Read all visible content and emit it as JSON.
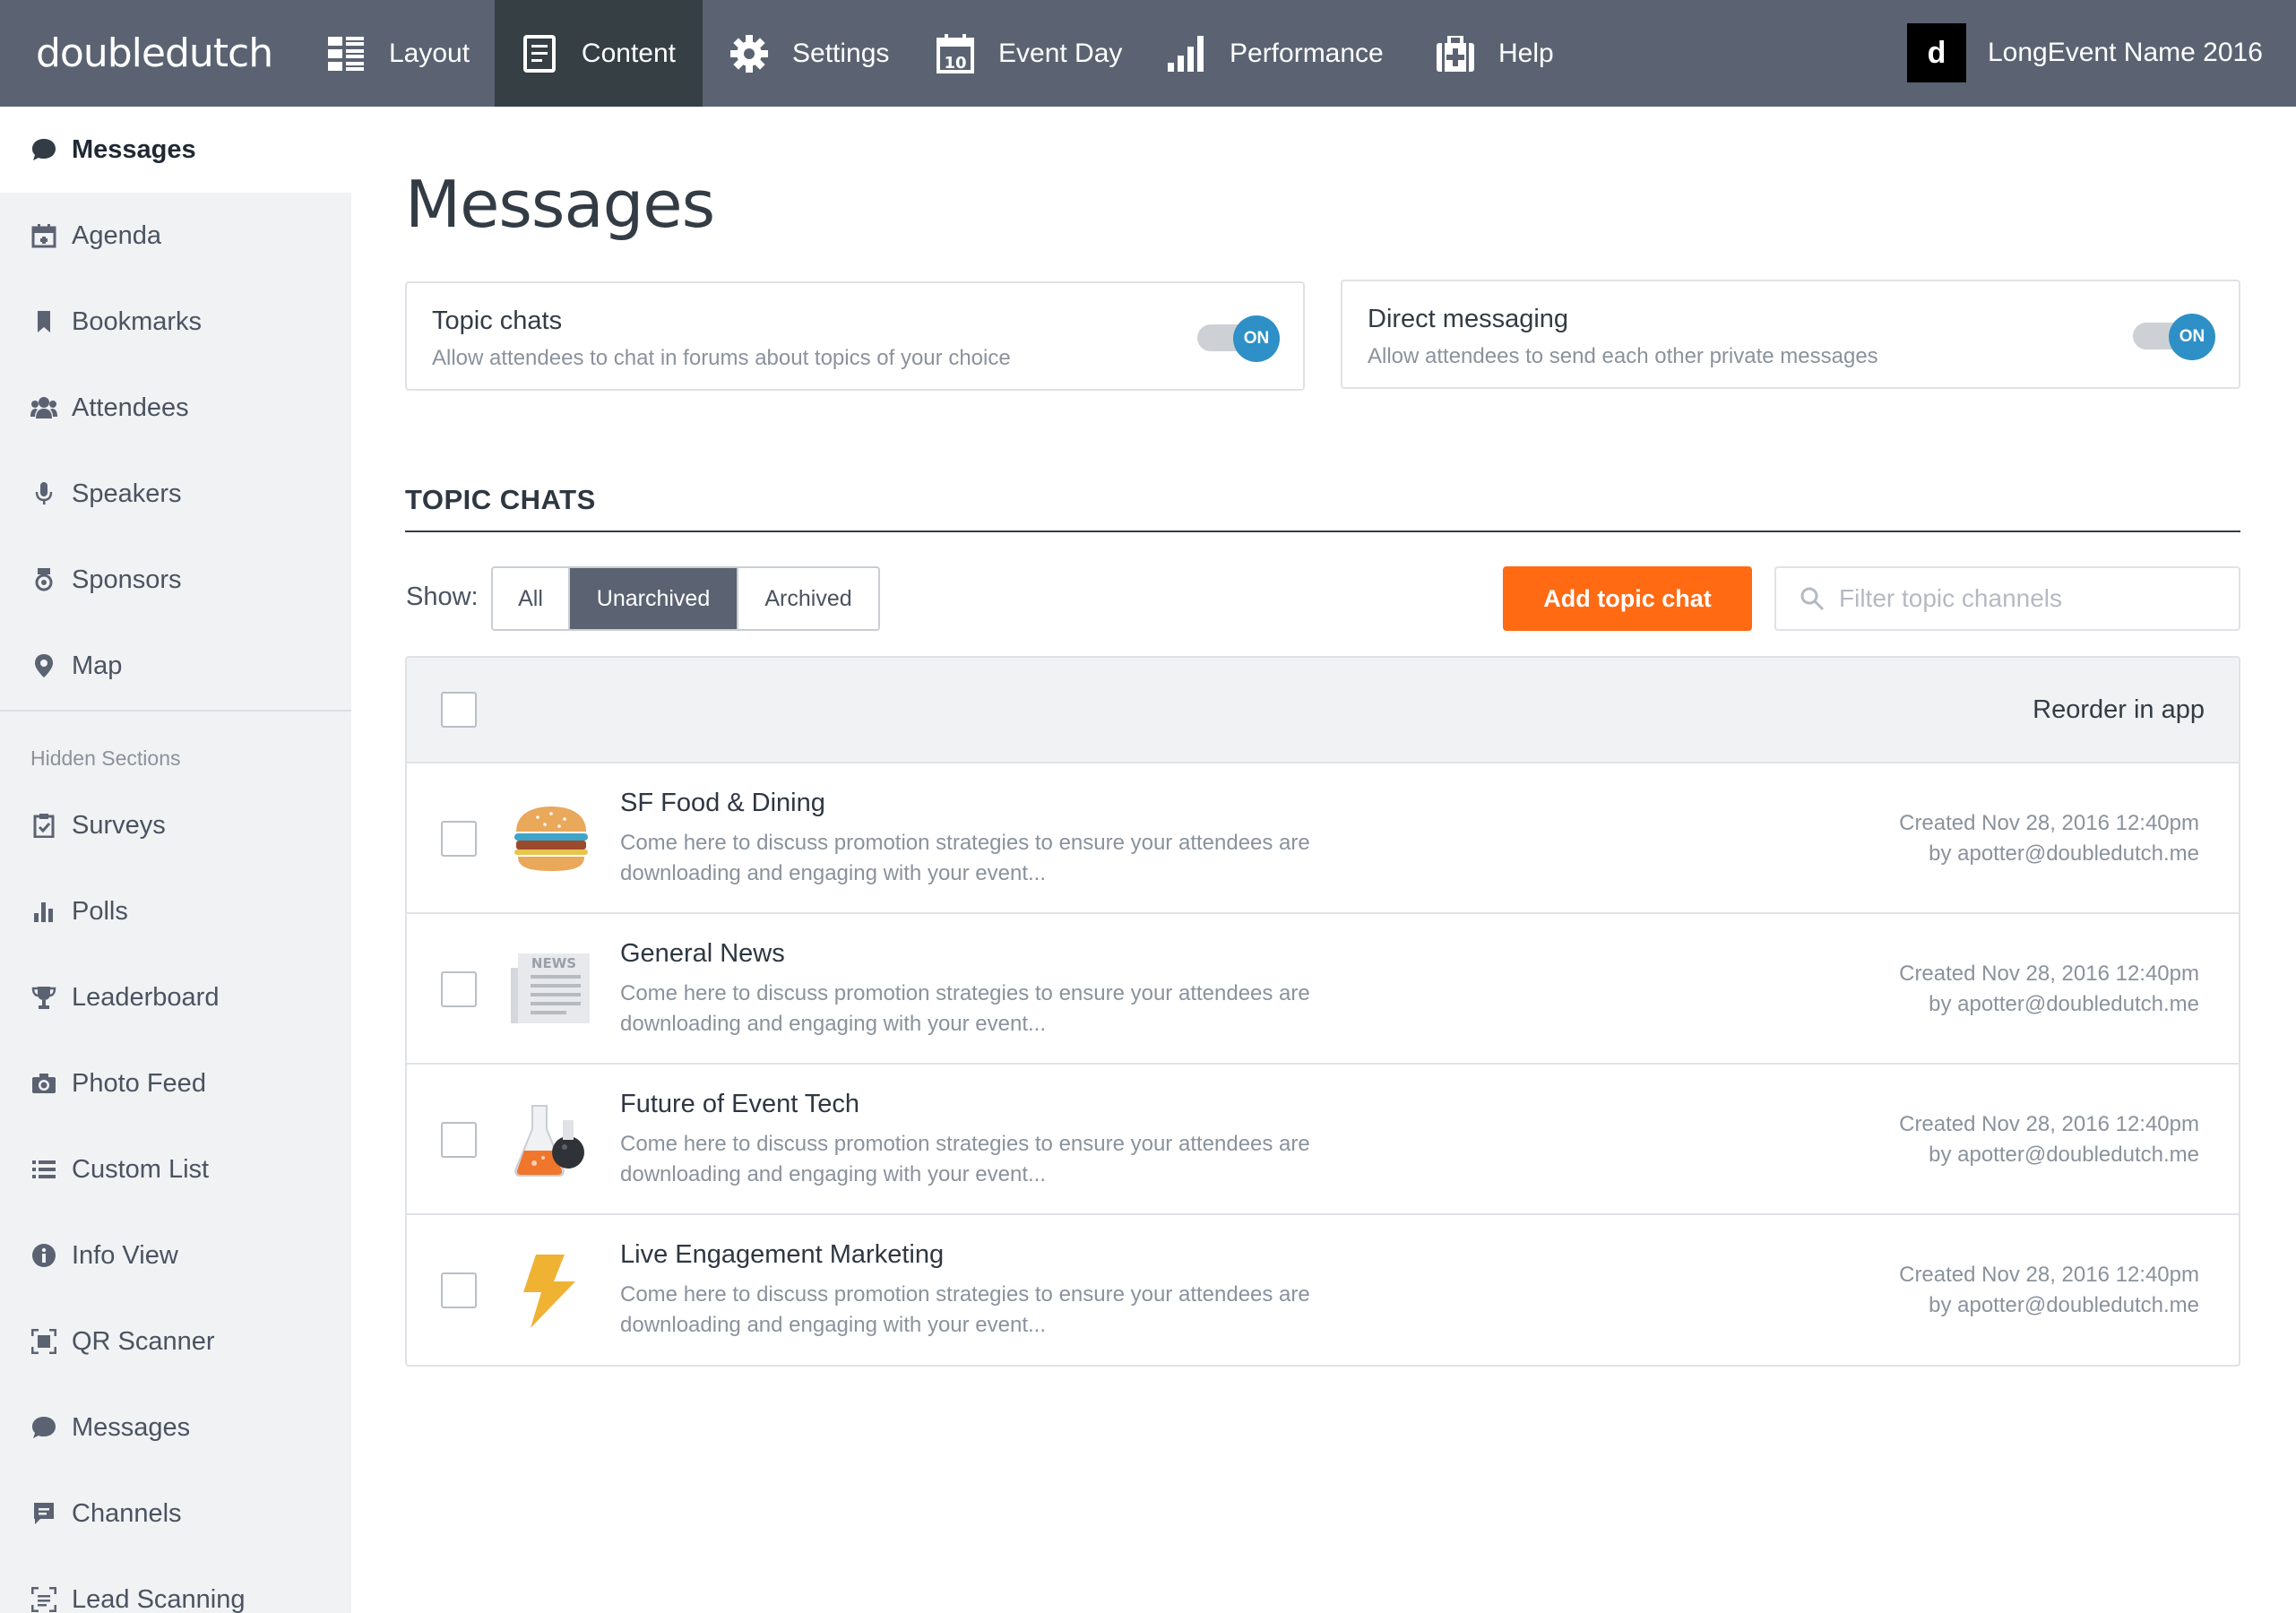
{
  "app": {
    "logo": "doubledutch",
    "event_badge": "d",
    "event_name": "LongEvent Name 2016"
  },
  "nav": [
    {
      "label": "Layout",
      "icon": "layout-icon"
    },
    {
      "label": "Content",
      "icon": "document-icon",
      "active": true
    },
    {
      "label": "Settings",
      "icon": "gear-icon"
    },
    {
      "label": "Event Day",
      "icon": "calendar-icon"
    },
    {
      "label": "Performance",
      "icon": "bar-chart-icon"
    },
    {
      "label": "Help",
      "icon": "first-aid-icon"
    }
  ],
  "sidebar": {
    "items": [
      {
        "label": "Messages",
        "icon": "chat-bubble-icon",
        "active": true
      },
      {
        "label": "Agenda",
        "icon": "calendar-icon"
      },
      {
        "label": "Bookmarks",
        "icon": "bookmark-icon"
      },
      {
        "label": "Attendees",
        "icon": "people-icon"
      },
      {
        "label": "Speakers",
        "icon": "microphone-icon"
      },
      {
        "label": "Sponsors",
        "icon": "ribbon-icon"
      },
      {
        "label": "Map",
        "icon": "map-pin-icon"
      }
    ],
    "hidden_label": "Hidden Sections",
    "hidden_items": [
      {
        "label": "Surveys",
        "icon": "clipboard-icon"
      },
      {
        "label": "Polls",
        "icon": "bar-chart-icon"
      },
      {
        "label": "Leaderboard",
        "icon": "trophy-icon"
      },
      {
        "label": "Photo Feed",
        "icon": "camera-icon"
      },
      {
        "label": "Custom List",
        "icon": "list-icon"
      },
      {
        "label": "Info View",
        "icon": "info-icon"
      },
      {
        "label": "QR Scanner",
        "icon": "qr-icon"
      },
      {
        "label": "Messages",
        "icon": "chat-bubble-icon"
      },
      {
        "label": "Channels",
        "icon": "channel-icon"
      },
      {
        "label": "Lead Scanning",
        "icon": "scan-icon"
      }
    ]
  },
  "main": {
    "title": "Messages",
    "cards": [
      {
        "title": "Topic chats",
        "desc": "Allow attendees to chat in forums about topics of your choice",
        "toggle": "ON"
      },
      {
        "title": "Direct messaging",
        "desc": "Allow attendees to send each other private messages",
        "toggle": "ON"
      }
    ],
    "section_title": "TOPIC CHATS",
    "show_label": "Show:",
    "filters": [
      {
        "label": "All"
      },
      {
        "label": "Unarchived",
        "selected": true
      },
      {
        "label": "Archived"
      }
    ],
    "add_button": "Add topic chat",
    "search_placeholder": "Filter topic channels",
    "table": {
      "reorder_label": "Reorder in app",
      "rows": [
        {
          "title": "SF Food & Dining",
          "desc": "Come here to discuss promotion strategies to ensure your attendees are downloading and engaging with your event...",
          "created": "Created Nov 28, 2016 12:40pm",
          "by": "by apotter@doubledutch.me",
          "icon": "burger-icon"
        },
        {
          "title": "General News",
          "desc": "Come here to discuss promotion strategies to ensure your attendees are downloading and engaging with your event...",
          "created": "Created Nov 28, 2016 12:40pm",
          "by": "by apotter@doubledutch.me",
          "icon": "newspaper-icon",
          "icon_text": "NEWS"
        },
        {
          "title": "Future of Event Tech",
          "desc": "Come here to discuss promotion strategies to ensure your attendees are downloading and engaging with your event...",
          "created": "Created Nov 28, 2016 12:40pm",
          "by": "by apotter@doubledutch.me",
          "icon": "flask-icon"
        },
        {
          "title": "Live Engagement Marketing",
          "desc": "Come here to discuss promotion strategies to ensure your attendees are downloading and engaging with your event...",
          "created": "Created Nov 28, 2016 12:40pm",
          "by": "by apotter@doubledutch.me",
          "icon": "lightning-icon"
        }
      ]
    }
  },
  "colors": {
    "topbar": "#5b6372",
    "active_nav": "#353f44",
    "accent_orange": "#ff6a13",
    "toggle_blue": "#2e90c6"
  }
}
